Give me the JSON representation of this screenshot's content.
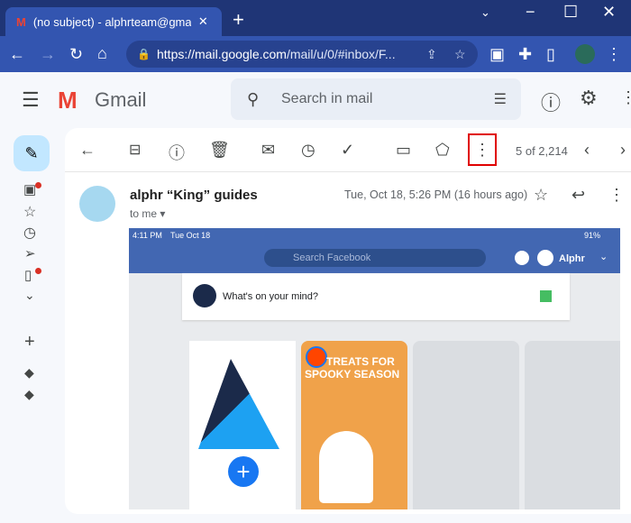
{
  "browser": {
    "tab_title": "(no subject) - alphrteam@gmail.c",
    "url_host": "https://mail.google.com",
    "url_path": "/mail/u/0/#inbox/F..."
  },
  "gmail": {
    "logo_text": "Gmail",
    "search_placeholder": "Search in mail"
  },
  "toolbar": {
    "pagination": "5 of 2,214"
  },
  "email": {
    "sender": "alphr “King” guides",
    "date": "Tue, Oct 18, 5:26 PM (16 hours ago)",
    "to": "to me"
  },
  "screenshot": {
    "time": "4:11 PM",
    "date": "Tue Oct 18",
    "battery": "91%",
    "search_placeholder": "Search Facebook",
    "profile_name": "Alphr",
    "composer_prompt": "What's on your mind?",
    "story_text": "TREATS FOR SPOOKY SEASON"
  },
  "colors": {
    "chrome_dark": "#1f3576",
    "chrome": "#3355b0",
    "facebook": "#4267b2",
    "highlight": "#e00000"
  }
}
